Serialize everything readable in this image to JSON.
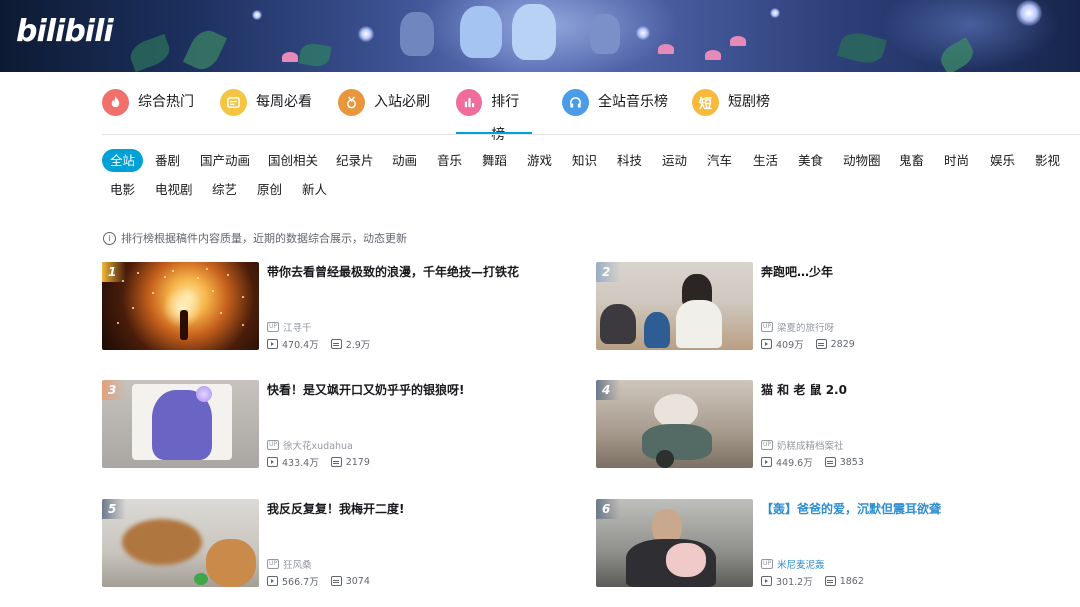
{
  "brand": {
    "logo_text": "bilibili"
  },
  "main_tabs": [
    {
      "label": "综合热门",
      "icon": "flame-icon",
      "color": "#f2706b"
    },
    {
      "label": "每周必看",
      "icon": "calendar-icon",
      "color": "#f5c542"
    },
    {
      "label": "入站必刷",
      "icon": "medal-icon",
      "color": "#e9963c"
    },
    {
      "label": "排行榜",
      "icon": "bar-chart-icon",
      "color": "#f06c9b",
      "active": true
    },
    {
      "label": "全站音乐榜",
      "icon": "headphones-icon",
      "color": "#4a9be8"
    },
    {
      "label": "短剧榜",
      "icon": "short-drama-icon",
      "color": "#f6b93b",
      "glyph": "短"
    }
  ],
  "categories": [
    "全站",
    "番剧",
    "国产动画",
    "国创相关",
    "纪录片",
    "动画",
    "音乐",
    "舞蹈",
    "游戏",
    "知识",
    "科技",
    "运动",
    "汽车",
    "生活",
    "美食",
    "动物圈",
    "鬼畜",
    "时尚",
    "娱乐",
    "影视",
    "电影",
    "电视剧",
    "综艺",
    "原创",
    "新人"
  ],
  "active_category": "全站",
  "note": "排行榜根据稿件内容质量，近期的数据综合展示，动态更新",
  "videos": [
    {
      "rank": "1",
      "title": "带你去看曾经最极致的浪漫，千年绝技—打铁花",
      "up_tag": "UP",
      "uploader": "江寻千",
      "views": "470.4万",
      "danmaku": "2.9万"
    },
    {
      "rank": "2",
      "title": "奔跑吧…少年",
      "up_tag": "UP",
      "uploader": "梁夏的旅行呀",
      "views": "409万",
      "danmaku": "2829"
    },
    {
      "rank": "3",
      "title": "快看！是又飒开口又奶乎乎的银狼呀!",
      "up_tag": "UP",
      "uploader": "徐大花xudahua",
      "views": "433.4万",
      "danmaku": "2179"
    },
    {
      "rank": "4",
      "title": "猫 和 老 鼠 2.0",
      "up_tag": "UP",
      "uploader": "奶糕成精档案社",
      "views": "449.6万",
      "danmaku": "3853"
    },
    {
      "rank": "5",
      "title": "我反反复复！我梅开二度!",
      "up_tag": "UP",
      "uploader": "狂风桑",
      "views": "566.7万",
      "danmaku": "3074"
    },
    {
      "rank": "6",
      "title": "【轰】爸爸的爱，沉默但震耳欲聋",
      "up_tag": "UP",
      "uploader": "米尼麦泥轰",
      "views": "301.2万",
      "danmaku": "1862"
    }
  ],
  "colors": {
    "accent": "#00a1d6",
    "link_blue": "#2f8ed2"
  }
}
